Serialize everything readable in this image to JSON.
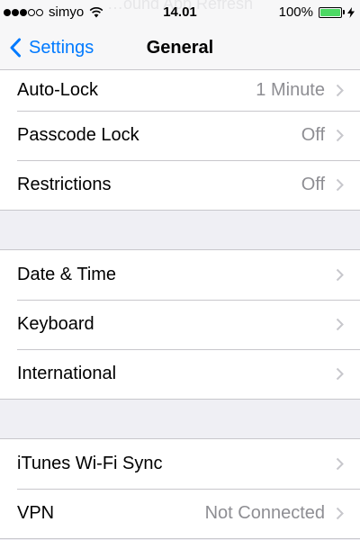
{
  "status_bar": {
    "ghost_text": "…ound App Refresh",
    "signal_filled": 3,
    "signal_total": 5,
    "carrier": "simyo",
    "wifi_icon": "wifi-icon",
    "time": "14.01",
    "battery_percent": "100%",
    "battery_level": 1.0,
    "battery_color": "#4cd964",
    "charging_icon": "bolt-icon"
  },
  "nav": {
    "back_label": "Settings",
    "back_icon": "chevron-left-icon",
    "title": "General",
    "accent_color": "#007aff"
  },
  "groups": [
    {
      "rows": [
        {
          "label": "Auto-Lock",
          "value": "1 Minute"
        },
        {
          "label": "Passcode Lock",
          "value": "Off"
        },
        {
          "label": "Restrictions",
          "value": "Off"
        }
      ]
    },
    {
      "rows": [
        {
          "label": "Date & Time",
          "value": ""
        },
        {
          "label": "Keyboard",
          "value": ""
        },
        {
          "label": "International",
          "value": ""
        }
      ]
    },
    {
      "rows": [
        {
          "label": "iTunes Wi-Fi Sync",
          "value": ""
        },
        {
          "label": "VPN",
          "value": "Not Connected"
        }
      ]
    }
  ]
}
